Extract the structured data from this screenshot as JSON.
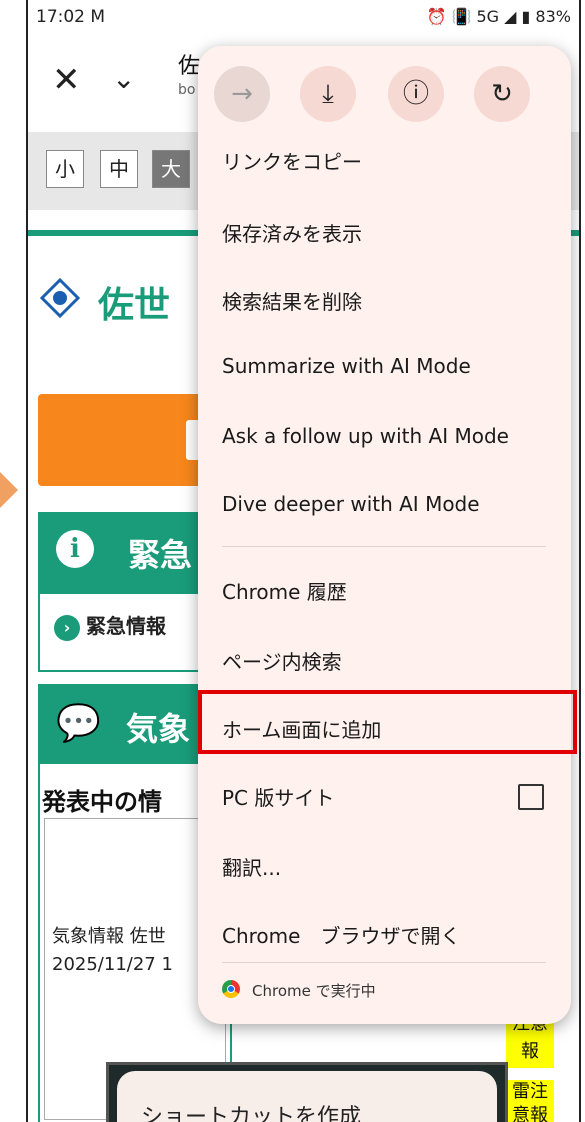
{
  "status_bar": {
    "time": "17:02 M",
    "right": "⏰ 📳 5G ◢ ▮ 83%"
  },
  "browser": {
    "title": "佐",
    "url": "bo"
  },
  "font_size": [
    "小",
    "中",
    "大"
  ],
  "site": {
    "logo_text": "佐世"
  },
  "emergency": {
    "title": "緊急",
    "link": "緊急情報"
  },
  "weather": {
    "title": "気象",
    "published": "発表中の情",
    "info": "気象情報 佐世",
    "date": "2025/11/27 1"
  },
  "badges": {
    "b1": "注意報",
    "b2": "雷注意報"
  },
  "dialog": {
    "title": "ショートカットを作成"
  },
  "menu": {
    "top_icons": [
      "forward-icon",
      "download-icon",
      "info-icon",
      "refresh-icon"
    ],
    "items": [
      "リンクをコピー",
      "保存済みを表示",
      "検索結果を削除",
      "Summarize with AI Mode",
      "Ask a follow up with AI Mode",
      "Dive deeper with AI Mode",
      "Chrome 履歴",
      "ページ内検索",
      "ホーム画面に追加",
      "PC 版サイト",
      "翻訳...",
      "Chrome　ブラウザで開く"
    ],
    "footer": "Chrome で実行中"
  },
  "colors": {
    "accent": "#1a9c7a",
    "orange": "#f7871c",
    "highlight": "#e00000",
    "menu_bg": "#fff2ee"
  }
}
